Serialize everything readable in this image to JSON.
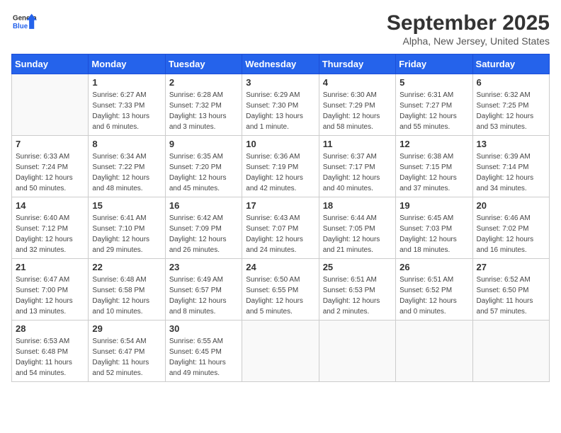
{
  "header": {
    "logo_line1": "General",
    "logo_line2": "Blue",
    "month": "September 2025",
    "location": "Alpha, New Jersey, United States"
  },
  "days_of_week": [
    "Sunday",
    "Monday",
    "Tuesday",
    "Wednesday",
    "Thursday",
    "Friday",
    "Saturday"
  ],
  "weeks": [
    [
      {
        "day": "",
        "info": ""
      },
      {
        "day": "1",
        "info": "Sunrise: 6:27 AM\nSunset: 7:33 PM\nDaylight: 13 hours\nand 6 minutes."
      },
      {
        "day": "2",
        "info": "Sunrise: 6:28 AM\nSunset: 7:32 PM\nDaylight: 13 hours\nand 3 minutes."
      },
      {
        "day": "3",
        "info": "Sunrise: 6:29 AM\nSunset: 7:30 PM\nDaylight: 13 hours\nand 1 minute."
      },
      {
        "day": "4",
        "info": "Sunrise: 6:30 AM\nSunset: 7:29 PM\nDaylight: 12 hours\nand 58 minutes."
      },
      {
        "day": "5",
        "info": "Sunrise: 6:31 AM\nSunset: 7:27 PM\nDaylight: 12 hours\nand 55 minutes."
      },
      {
        "day": "6",
        "info": "Sunrise: 6:32 AM\nSunset: 7:25 PM\nDaylight: 12 hours\nand 53 minutes."
      }
    ],
    [
      {
        "day": "7",
        "info": "Sunrise: 6:33 AM\nSunset: 7:24 PM\nDaylight: 12 hours\nand 50 minutes."
      },
      {
        "day": "8",
        "info": "Sunrise: 6:34 AM\nSunset: 7:22 PM\nDaylight: 12 hours\nand 48 minutes."
      },
      {
        "day": "9",
        "info": "Sunrise: 6:35 AM\nSunset: 7:20 PM\nDaylight: 12 hours\nand 45 minutes."
      },
      {
        "day": "10",
        "info": "Sunrise: 6:36 AM\nSunset: 7:19 PM\nDaylight: 12 hours\nand 42 minutes."
      },
      {
        "day": "11",
        "info": "Sunrise: 6:37 AM\nSunset: 7:17 PM\nDaylight: 12 hours\nand 40 minutes."
      },
      {
        "day": "12",
        "info": "Sunrise: 6:38 AM\nSunset: 7:15 PM\nDaylight: 12 hours\nand 37 minutes."
      },
      {
        "day": "13",
        "info": "Sunrise: 6:39 AM\nSunset: 7:14 PM\nDaylight: 12 hours\nand 34 minutes."
      }
    ],
    [
      {
        "day": "14",
        "info": "Sunrise: 6:40 AM\nSunset: 7:12 PM\nDaylight: 12 hours\nand 32 minutes."
      },
      {
        "day": "15",
        "info": "Sunrise: 6:41 AM\nSunset: 7:10 PM\nDaylight: 12 hours\nand 29 minutes."
      },
      {
        "day": "16",
        "info": "Sunrise: 6:42 AM\nSunset: 7:09 PM\nDaylight: 12 hours\nand 26 minutes."
      },
      {
        "day": "17",
        "info": "Sunrise: 6:43 AM\nSunset: 7:07 PM\nDaylight: 12 hours\nand 24 minutes."
      },
      {
        "day": "18",
        "info": "Sunrise: 6:44 AM\nSunset: 7:05 PM\nDaylight: 12 hours\nand 21 minutes."
      },
      {
        "day": "19",
        "info": "Sunrise: 6:45 AM\nSunset: 7:03 PM\nDaylight: 12 hours\nand 18 minutes."
      },
      {
        "day": "20",
        "info": "Sunrise: 6:46 AM\nSunset: 7:02 PM\nDaylight: 12 hours\nand 16 minutes."
      }
    ],
    [
      {
        "day": "21",
        "info": "Sunrise: 6:47 AM\nSunset: 7:00 PM\nDaylight: 12 hours\nand 13 minutes."
      },
      {
        "day": "22",
        "info": "Sunrise: 6:48 AM\nSunset: 6:58 PM\nDaylight: 12 hours\nand 10 minutes."
      },
      {
        "day": "23",
        "info": "Sunrise: 6:49 AM\nSunset: 6:57 PM\nDaylight: 12 hours\nand 8 minutes."
      },
      {
        "day": "24",
        "info": "Sunrise: 6:50 AM\nSunset: 6:55 PM\nDaylight: 12 hours\nand 5 minutes."
      },
      {
        "day": "25",
        "info": "Sunrise: 6:51 AM\nSunset: 6:53 PM\nDaylight: 12 hours\nand 2 minutes."
      },
      {
        "day": "26",
        "info": "Sunrise: 6:51 AM\nSunset: 6:52 PM\nDaylight: 12 hours\nand 0 minutes."
      },
      {
        "day": "27",
        "info": "Sunrise: 6:52 AM\nSunset: 6:50 PM\nDaylight: 11 hours\nand 57 minutes."
      }
    ],
    [
      {
        "day": "28",
        "info": "Sunrise: 6:53 AM\nSunset: 6:48 PM\nDaylight: 11 hours\nand 54 minutes."
      },
      {
        "day": "29",
        "info": "Sunrise: 6:54 AM\nSunset: 6:47 PM\nDaylight: 11 hours\nand 52 minutes."
      },
      {
        "day": "30",
        "info": "Sunrise: 6:55 AM\nSunset: 6:45 PM\nDaylight: 11 hours\nand 49 minutes."
      },
      {
        "day": "",
        "info": ""
      },
      {
        "day": "",
        "info": ""
      },
      {
        "day": "",
        "info": ""
      },
      {
        "day": "",
        "info": ""
      }
    ]
  ]
}
